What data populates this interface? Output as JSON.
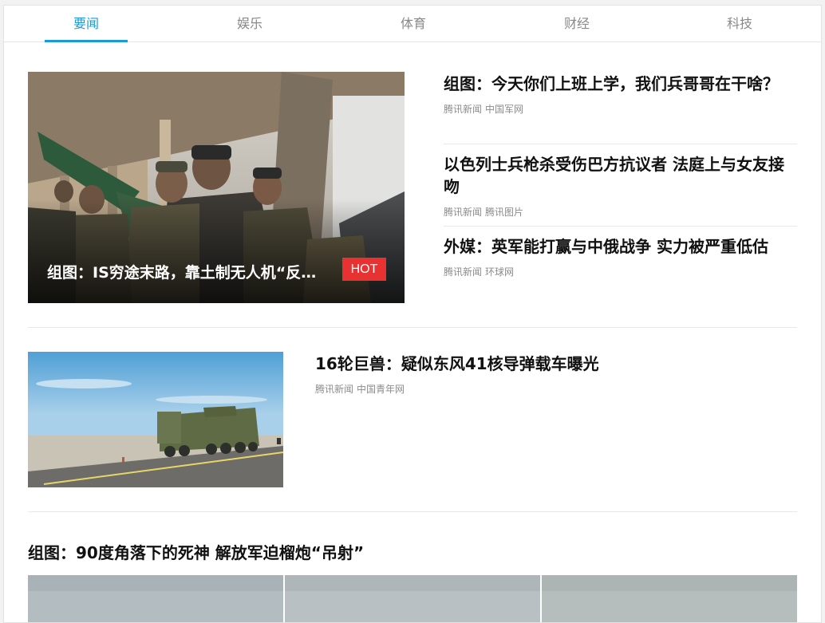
{
  "tabs": [
    {
      "label": "要闻",
      "active": true
    },
    {
      "label": "娱乐",
      "active": false
    },
    {
      "label": "体育",
      "active": false
    },
    {
      "label": "财经",
      "active": false
    },
    {
      "label": "科技",
      "active": false
    }
  ],
  "hero": {
    "caption": "组图：IS穷途末路，靠土制无人机“反…",
    "badge": "HOT",
    "image_icon": "photo-soldiers-drone"
  },
  "side_articles": [
    {
      "title": "组图：今天你们上班上学，我们兵哥哥在干啥？",
      "source": "腾讯新闻",
      "partner": "中国军网"
    },
    {
      "title": "以色列士兵枪杀受伤巴方抗议者 法庭上与女友接吻",
      "source": "腾讯新闻",
      "partner": "腾讯图片"
    },
    {
      "title": "外媒：英军能打赢与中俄战争 实力被严重低估",
      "source": "腾讯新闻",
      "partner": "环球网"
    }
  ],
  "feature_article": {
    "title": "16轮巨兽：疑似东风41核导弹载车曝光",
    "source": "腾讯新闻",
    "partner": "中国青年网",
    "image_icon": "photo-missile-truck"
  },
  "gallery_article": {
    "title": "组图：90度角落下的死神 解放军迫榴炮“吊射”",
    "images": [
      "photo-foggy-1",
      "photo-foggy-2",
      "photo-foggy-3"
    ]
  },
  "colors": {
    "accent": "#1a9bd7",
    "hot": "#e83232",
    "meta": "#8c8c8c"
  }
}
